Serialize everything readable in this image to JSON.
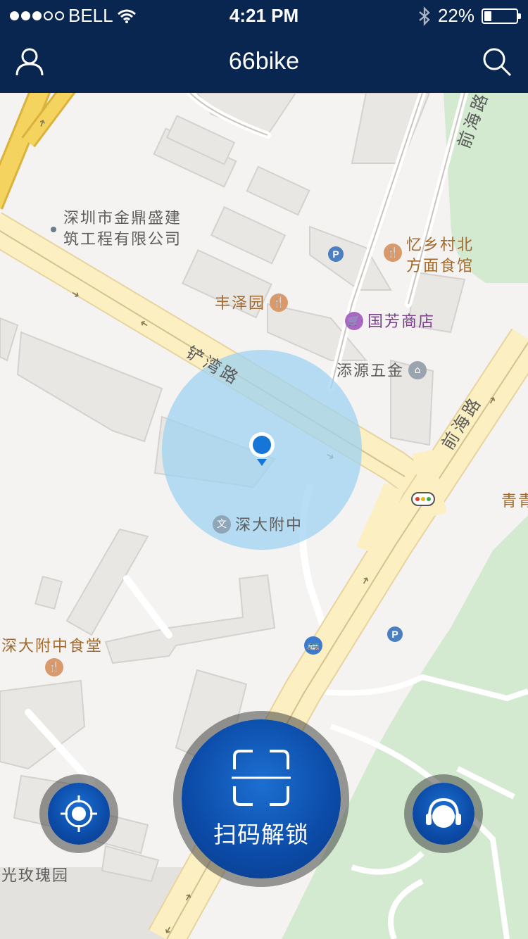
{
  "status_bar": {
    "carrier": "BELL",
    "time": "4:21 PM",
    "battery": "22%",
    "battery_level": 0.22,
    "signal_bars_filled": 3,
    "signal_bars_total": 5
  },
  "header": {
    "title": "66bike",
    "left_icon": "user-icon",
    "right_icon": "search-icon",
    "background": "#082650"
  },
  "map": {
    "roads": {
      "chanwan": "铲湾路",
      "qianhai_top": "前海路",
      "qianhai_right": "前海路"
    },
    "pois": {
      "company": "深圳市金鼎盛建\n筑工程有限公司",
      "yixiangcun": "忆乡村北\n方面食馆",
      "fengzeyuan": "丰泽园",
      "guofang": "国芳商店",
      "tianyuan": "添源五金",
      "shendafuzhong": "深大附中",
      "canteen": "深大附中食堂",
      "qing": "青青",
      "meiguiyuan": "光玫瑰园"
    },
    "location_accuracy_color": "#9fd3f0",
    "location_pin_color": "#1676d8"
  },
  "actions": {
    "scan_label": "扫码解锁",
    "locate_icon": "locate-icon",
    "service_icon": "headset-icon",
    "button_color": "#0b4aa6"
  }
}
